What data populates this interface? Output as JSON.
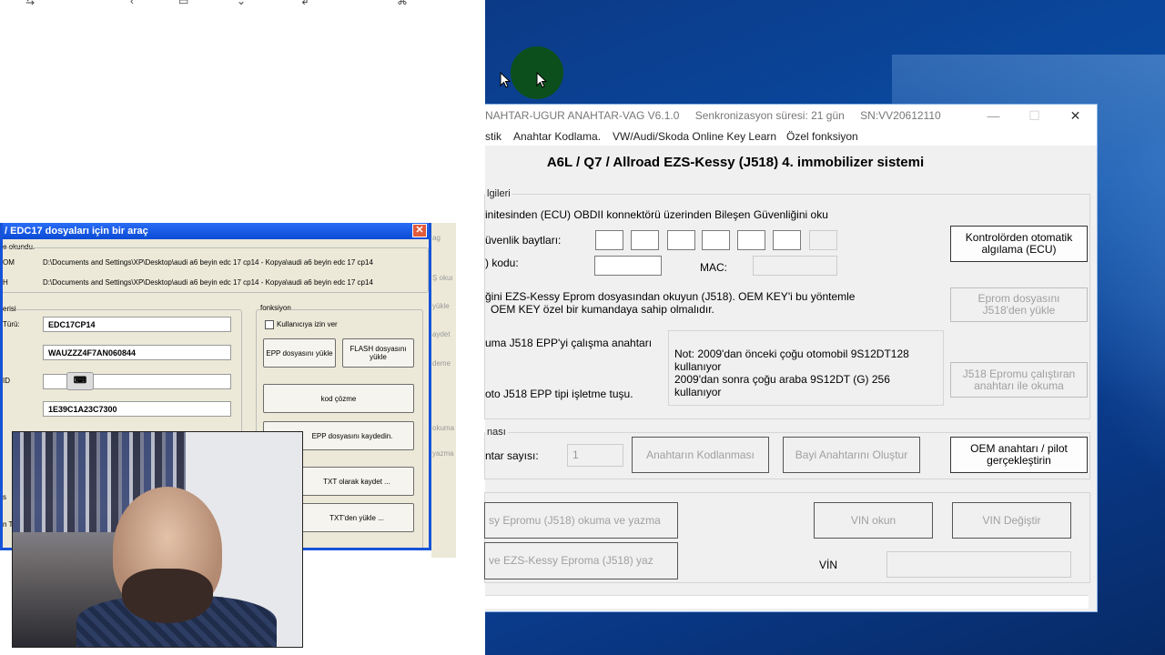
{
  "left_panel": {
    "toolbar_icons": [
      "undo-icon",
      "back-icon",
      "save-icon",
      "dropdown-icon",
      "redo-icon",
      "share-icon"
    ]
  },
  "xp_dialog": {
    "title": "/ EDC17 dosyaları için bir araç",
    "subtitle": "e okundu.",
    "row1_label": "OM",
    "row1_path": "D:\\Documents and Settings\\XP\\Desktop\\audi a6 beyin edc 17 cp14 - Kopya\\audi a6 beyin edc 17 cp14",
    "row2_label": "H",
    "row2_path": "D:\\Documents and Settings\\XP\\Desktop\\audi a6 beyin edc 17 cp14 - Kopya\\audi a6 beyin edc 17 cp14",
    "info_group_label": "erisi",
    "type_label": "Türü:",
    "type_value": "EDC17CP14",
    "vin_value": "WAUZZZ4F7AN060844",
    "id_label": "ID",
    "code_value": "1E39C1A23C7300",
    "fonksiyon_label": "fonksiyon",
    "checkbox_label": "Kullanıcıya izin ver",
    "epp_load": "EPP dosyasını yükle",
    "flash_load": "FLASH dosyasını yükle",
    "kod_cozme": "kod çözme",
    "epp_save": "EPP dosyasını kaydedin.",
    "txt_save": "TXT olarak kaydet ...",
    "txt_load": "TXT'den yükle ...",
    "side_labels": [
      "ag",
      "Ş okuı",
      "yükle",
      "aydet",
      "deme",
      "okuma",
      "yazma"
    ],
    "left_edge_labels": [
      "s",
      "n Tü"
    ]
  },
  "app": {
    "title": "NAHTAR-UGUR ANAHTAR-VAG V6.1.0",
    "sync_label": "Senkronizasyon süresi: 21 gün",
    "serial": "SN:VV20612110",
    "menu": [
      "stik",
      "Anahtar Kodlama.",
      "VW/Audi/Skoda Online Key Learn",
      "Özel fonksiyon"
    ],
    "heading": "A6L / Q7 / Allroad EZS-Kessy (J518) 4. immobilizer sistemi",
    "group1_label": "lgileri",
    "obd_text": "initesinden (ECU) OBDII konnektörü üzerinden Bileşen Güvenliğini oku",
    "security_bytes_label": "üvenlik baytları:",
    "code_label": ") kodu:",
    "mac_label": "MAC:",
    "auto_detect_button": "Kontrolörden otomatik algılama (ECU)",
    "eprom_text_1": "ğini EZS-Kessy Eprom dosyasından okuyun (J518). OEM KEY'i bu yöntemle",
    "eprom_text_2": "OEM KEY özel bir kumandaya sahip olmalıdır.",
    "eprom_load_button": "Eprom dosyasını J518'den yükle",
    "epp_text": "uma J518 EPP'yi çalışma anahtarı",
    "note_line1": "Not: 2009'dan önceki çoğu otomobil 9S12DT128",
    "note_line2": "kullanıyor",
    "note_line3": "2009'dan sonra çoğu araba 9S12DT (G) 256",
    "note_line4": "kullanıyor",
    "epp_text_2": "oto J518 EPP tipi işletme tuşu.",
    "j518_button": "J518 Epromu çalıştıran anahtarı ile okuma",
    "group2_label": "nası",
    "key_count_label": "ntar sayısı:",
    "key_count_value": "1",
    "coding_button": "Anahtarın Kodlanması",
    "dealer_button": "Bayi Anahtarını Oluştur",
    "oem_button": "OEM anahtarı / pilot gerçekleştirin",
    "read_write_button": "sy Epromu (J518) okuma ve yazma",
    "write_button": "ve EZS-Kessy Eproma (J518) yaz",
    "vin_read_button": "VIN okun",
    "vin_change_button": "VIN Değiştir",
    "vin_label": "VİN"
  }
}
